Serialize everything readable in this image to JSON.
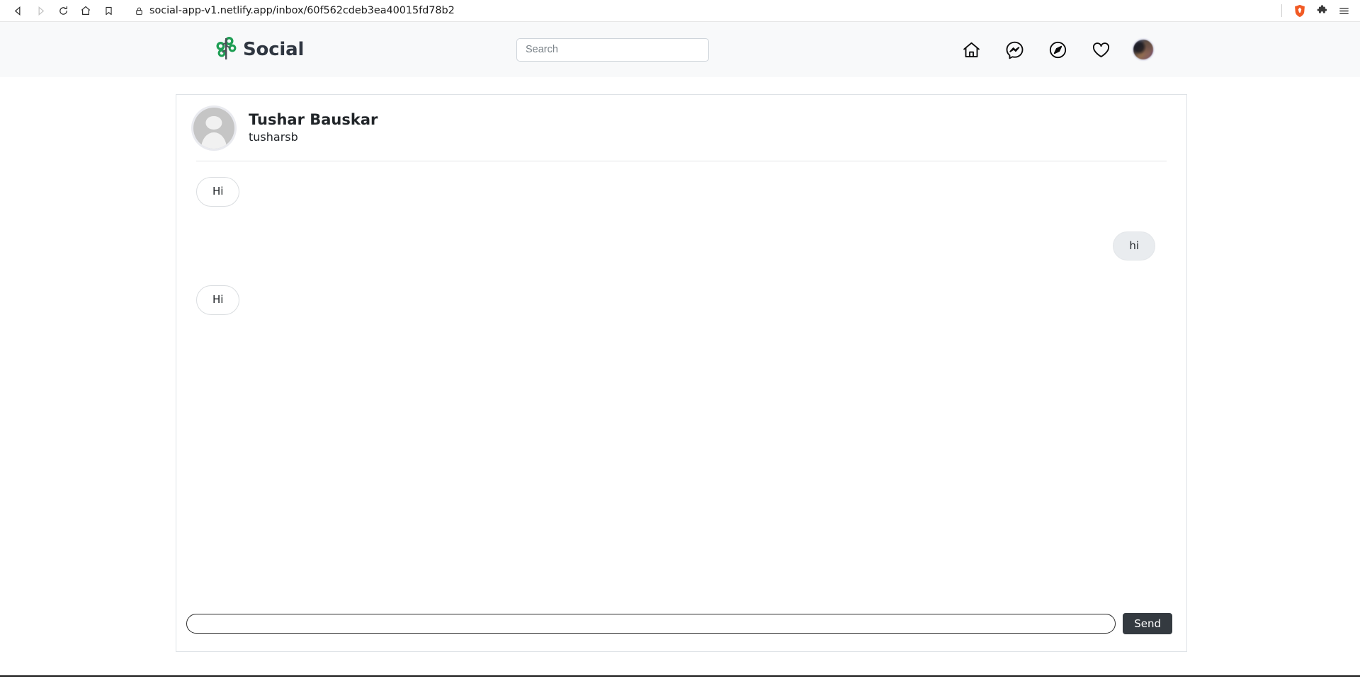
{
  "browser": {
    "url": "social-app-v1.netlify.app/inbox/60f562cdeb3ea40015fd78b2",
    "back_icon": "back-arrow-icon",
    "forward_icon": "forward-arrow-icon",
    "reload_icon": "reload-icon",
    "home_icon": "home-icon",
    "bookmark_icon": "bookmark-icon",
    "lock_icon": "lock-icon",
    "shield_icon": "brave-shield-icon",
    "extensions_icon": "puzzle-icon",
    "menu_icon": "hamburger-menu-icon"
  },
  "header": {
    "brand": "Social",
    "brand_icon": "tree-logo-icon",
    "brand_color": "#1e9e53",
    "brand_text_color": "#2f3640",
    "search": {
      "placeholder": "Search",
      "value": ""
    },
    "nav": [
      {
        "name": "home-icon",
        "label": "Home"
      },
      {
        "name": "messenger-icon",
        "label": "Messages"
      },
      {
        "name": "compass-icon",
        "label": "Explore"
      },
      {
        "name": "heart-icon",
        "label": "Notifications"
      },
      {
        "name": "profile-avatar",
        "label": "Profile"
      }
    ]
  },
  "chat": {
    "peer": {
      "name": "Tushar Bauskar",
      "handle": "tusharsb",
      "avatar": "default-avatar-placeholder"
    },
    "messages": [
      {
        "text": "Hi",
        "direction": "incoming"
      },
      {
        "text": "hi",
        "direction": "outgoing"
      },
      {
        "text": "Hi",
        "direction": "incoming"
      }
    ],
    "composer": {
      "placeholder": "",
      "value": "",
      "send_label": "Send",
      "send_bg": "#343a40"
    }
  }
}
